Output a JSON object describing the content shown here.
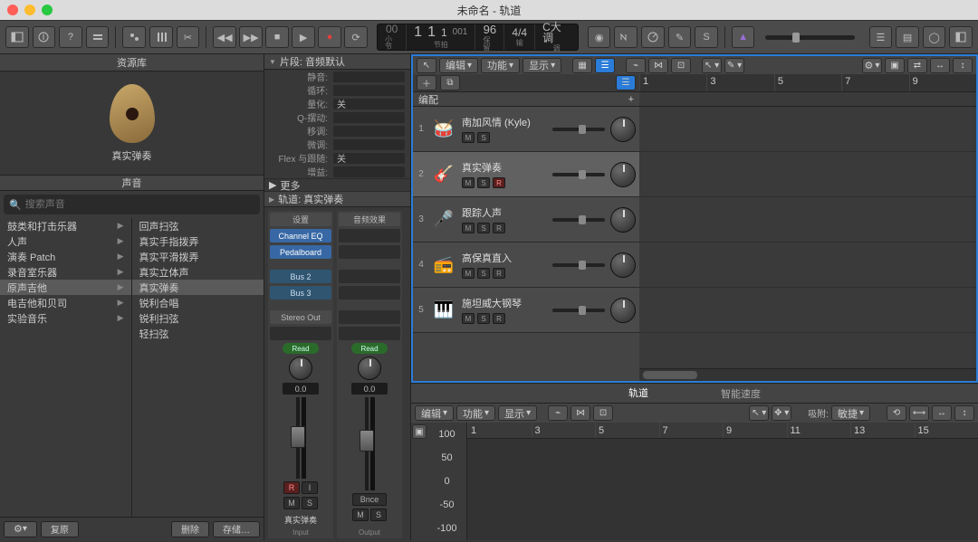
{
  "window": {
    "title": "未命名 - 轨道"
  },
  "lcd": {
    "bar": "1",
    "beat": "1",
    "div": "1",
    "ticks": "1",
    "ticks_sub": "001",
    "sub_bar": "小节",
    "sub_tempo": "节拍",
    "tempo": "96",
    "tempo_sub": "保留",
    "sig": "4/4",
    "sig_sub": "输",
    "key": "C大调",
    "key_sub": "调"
  },
  "library": {
    "header": "资源库",
    "patch_name": "真实弹奏",
    "sounds_header": "声音",
    "search_placeholder": "搜索声音",
    "categories": [
      "鼓类和打击乐器",
      "人声",
      "演奏 Patch",
      "录音室乐器",
      "原声吉他",
      "电吉他和贝司",
      "实验音乐"
    ],
    "category_selected": 4,
    "presets": [
      "回声扫弦",
      "真实手指拨弄",
      "真实平滑拨弄",
      "真实立体声",
      "真实弹奏",
      "锐利合唱",
      "锐利扫弦",
      "轻扫弦"
    ],
    "preset_selected": 4,
    "footer": {
      "gear": "⚙",
      "undo": "复原",
      "delete": "删除",
      "save": "存储…"
    }
  },
  "inspector": {
    "region_header": "片段: 音频默认",
    "params": [
      {
        "label": "静音:",
        "value": ""
      },
      {
        "label": "循环:",
        "value": ""
      },
      {
        "label": "量化:",
        "value": "关"
      },
      {
        "label": "Q-摆动:",
        "value": ""
      },
      {
        "label": "移调:",
        "value": ""
      },
      {
        "label": "微调:",
        "value": ""
      },
      {
        "label": "Flex 与跟随:",
        "value": "关"
      },
      {
        "label": "增益:",
        "value": ""
      }
    ],
    "more": "更多",
    "track_header": "轨道: 真实弹奏",
    "ch": {
      "setting": "设置",
      "audiofx": "音频效果",
      "slots": [
        "Channel EQ",
        "Pedalboard"
      ],
      "sends": [
        "Bus 2",
        "Bus 3"
      ],
      "out": "Stereo Out",
      "read": "Read",
      "pan": "0.0",
      "m": "M",
      "s": "S",
      "r": "R",
      "i": "I",
      "bnce": "Bnce",
      "name1": "真实弹奏",
      "sub1": "Input",
      "name2": "",
      "sub2": "Output"
    }
  },
  "arrange": {
    "menus": {
      "edit": "编辑",
      "func": "功能",
      "view": "显示"
    },
    "header_row": "编配",
    "tracks": [
      {
        "num": "1",
        "icon": "🥁",
        "name": "南加风情 (Kyle)",
        "m": "M",
        "s": "S",
        "r": ""
      },
      {
        "num": "2",
        "icon": "🎸",
        "name": "真实弹奏",
        "m": "M",
        "s": "S",
        "r": "R"
      },
      {
        "num": "3",
        "icon": "🎤",
        "name": "跟踪人声",
        "m": "M",
        "s": "S",
        "r": "R"
      },
      {
        "num": "4",
        "icon": "📻",
        "name": "高保真直入",
        "m": "M",
        "s": "S",
        "r": "R"
      },
      {
        "num": "5",
        "icon": "🎹",
        "name": "施坦威大钢琴",
        "m": "M",
        "s": "S",
        "r": "R"
      }
    ],
    "track_selected": 1,
    "ruler": [
      "1",
      "3",
      "5",
      "7",
      "9"
    ]
  },
  "editor": {
    "tabs": {
      "track": "轨道",
      "smart": "智能速度"
    },
    "toolbar": {
      "edit": "编辑",
      "func": "功能",
      "view": "显示",
      "snap": "吸附:",
      "snap_val": "敏捷"
    },
    "ruler": [
      "1",
      "3",
      "5",
      "7",
      "9",
      "11",
      "13",
      "15"
    ],
    "side": [
      "100",
      "50",
      "0",
      "-50",
      "-100"
    ]
  }
}
